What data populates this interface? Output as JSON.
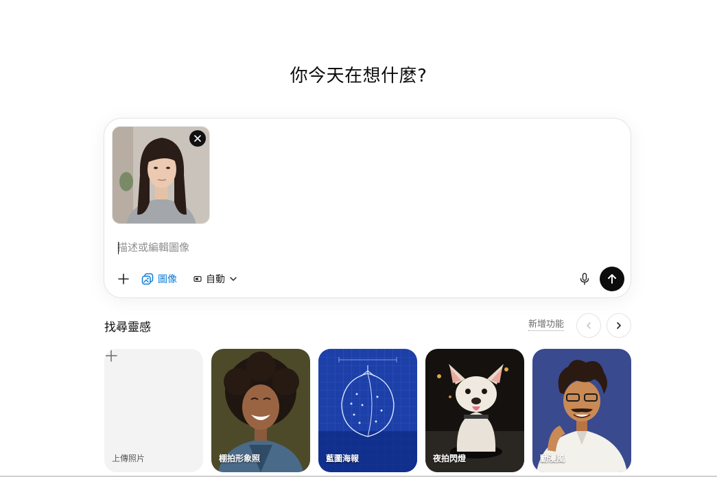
{
  "headline": "你今天在想什麼?",
  "composer": {
    "placeholder": "描述或編輯圖像",
    "image_tool_label": "圖像",
    "aspect_label": "自動"
  },
  "inspiration": {
    "title": "找尋靈感",
    "new_features_link": "新增功能",
    "cards": [
      {
        "label": "上傳照片"
      },
      {
        "label": "棚拍形象照"
      },
      {
        "label": "藍圖海報"
      },
      {
        "label": "夜拍閃燈"
      },
      {
        "label": "動漫風"
      }
    ]
  },
  "colors": {
    "accent_blue": "#0a7ad6",
    "send_button": "#0d0d0d"
  },
  "icons": [
    "plus-icon",
    "image-icon",
    "aspect-ratio-icon",
    "chevron-down-icon",
    "microphone-icon",
    "arrow-up-icon",
    "close-icon",
    "chevron-left-icon",
    "chevron-right-icon"
  ]
}
